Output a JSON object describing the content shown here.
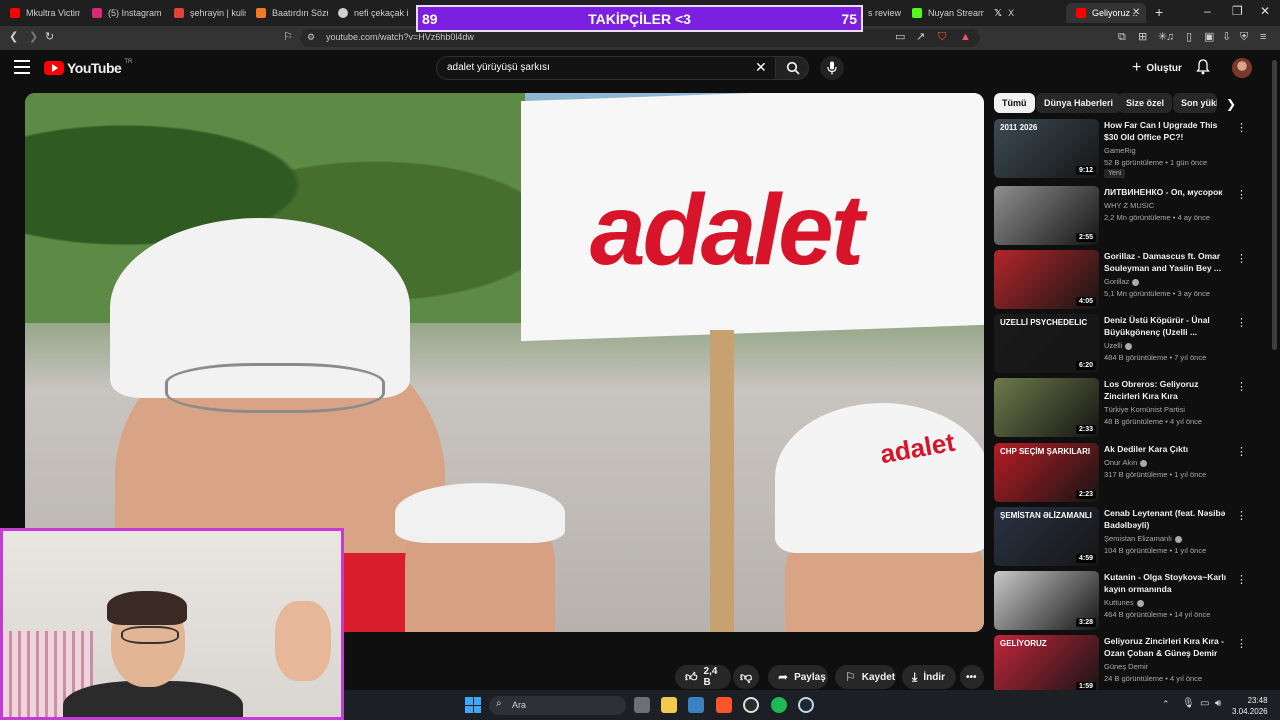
{
  "browser": {
    "tabs": [
      {
        "label": "Mkultra Victim",
        "color": "#ff0000"
      },
      {
        "label": "(5) Instagram",
        "color": "#d62976"
      },
      {
        "label": "şehrayin | kulis",
        "color": "#e2423a"
      },
      {
        "label": "Baatırdın Sözü",
        "color": "#ef7b27"
      },
      {
        "label": "nefi çekaçak i s",
        "color": "#cfcfcf"
      },
      {
        "label": "s review",
        "color": "#9a9a9a"
      },
      {
        "label": "Nuyan Stream",
        "color": "#53fc18"
      },
      {
        "label": "X",
        "color": "#ffffff"
      },
      {
        "label": "Geliyoruz ..",
        "color": "#ff0000"
      }
    ],
    "url": "youtube.com/watch?v=HVz6hb0l4dw"
  },
  "overlay": {
    "left_value": "89",
    "title": "TAKİPÇİLER <3",
    "right_value": "75"
  },
  "header": {
    "logo_text": "YouTube",
    "logo_region": "TR",
    "search_query": "adalet yürüyüşü şarkısı",
    "create_label": "Oluştur"
  },
  "video": {
    "sign_text": "adalet",
    "cap_text": "adalet"
  },
  "actions": {
    "like_count": "2,4 B",
    "share_label": "Paylaş",
    "save_label": "Kaydet",
    "download_label": "İndir"
  },
  "chips": [
    "Tümü",
    "Dünya Haberleri",
    "Size özel",
    "Son yükl"
  ],
  "recommendations": [
    {
      "title": "How Far Can I Upgrade This $30 Old Office PC?!",
      "channel": "GameRig",
      "verified": false,
      "meta": "52 B görüntüleme • 1 gün önce",
      "duration": "9:12",
      "badge": "Yeni",
      "thumb": "#3d4b55",
      "thumb_text": "2011        2026"
    },
    {
      "title": "ЛИТВИНЕНКО - Оп, мусорок",
      "channel": "WHY Z MUSIC",
      "verified": false,
      "meta": "2,2 Mn görüntüleme • 4 ay önce",
      "duration": "2:55",
      "badge": "",
      "thumb": "#8f8f8f",
      "thumb_text": ""
    },
    {
      "title": "Gorillaz - Damascus ft. Omar Souleyman and Yasiin Bey ...",
      "channel": "Gorillaz",
      "verified": true,
      "meta": "5,1 Mn görüntüleme • 3 ay önce",
      "duration": "4:05",
      "badge": "",
      "thumb": "#b3262a",
      "thumb_text": ""
    },
    {
      "title": "Deniz Üstü Köpürür - Ünal Büyükgönenç (Uzelli ...",
      "channel": "Uzelli",
      "verified": true,
      "meta": "484 B görüntüleme • 7 yıl önce",
      "duration": "6:20",
      "badge": "",
      "thumb": "#1a1a1a",
      "thumb_text": "UZELLİ PSYCHEDELIC"
    },
    {
      "title": "Los Obreros: Geliyoruz Zincirleri Kıra Kıra",
      "channel": "Türkiye Komünist Partisi",
      "verified": false,
      "meta": "48 B görüntüleme • 4 yıl önce",
      "duration": "2:33",
      "badge": "",
      "thumb": "#6d7a4a",
      "thumb_text": ""
    },
    {
      "title": "Ak Dediler Kara Çıktı",
      "channel": "Onur Akın",
      "verified": true,
      "meta": "317 B görüntüleme • 1 yıl önce",
      "duration": "2:23",
      "badge": "",
      "thumb": "#b81c24",
      "thumb_text": "CHP SEÇİM ŞARKILARI"
    },
    {
      "title": "Cenab Leytenant (feat. Nəsibə Badəlbəyli)",
      "channel": "Şemistan Elizamanlı",
      "verified": true,
      "meta": "104 B görüntüleme • 1 yıl önce",
      "duration": "4:59",
      "badge": "",
      "thumb": "#2a3344",
      "thumb_text": "ŞEMİSTAN ƏLİZAMANLI"
    },
    {
      "title": "Kutanin - Olga Stoykova~Karlı kayın ormanında",
      "channel": "Kuttunes",
      "verified": true,
      "meta": "464 B görüntüleme • 14 yıl önce",
      "duration": "3:28",
      "badge": "",
      "thumb": "#c9c9c9",
      "thumb_text": ""
    },
    {
      "title": "Geliyoruz Zincirleri Kıra Kıra - Ozan Çoban & Güneş Demir",
      "channel": "Güneş Demir",
      "verified": false,
      "meta": "24 B görüntüleme • 4 yıl önce",
      "duration": "1:59",
      "badge": "",
      "thumb": "#c2253a",
      "thumb_text": "GELİYORUZ"
    }
  ],
  "taskbar": {
    "search_placeholder": "Ara",
    "time": "23:48",
    "date": "3.04.2026"
  }
}
